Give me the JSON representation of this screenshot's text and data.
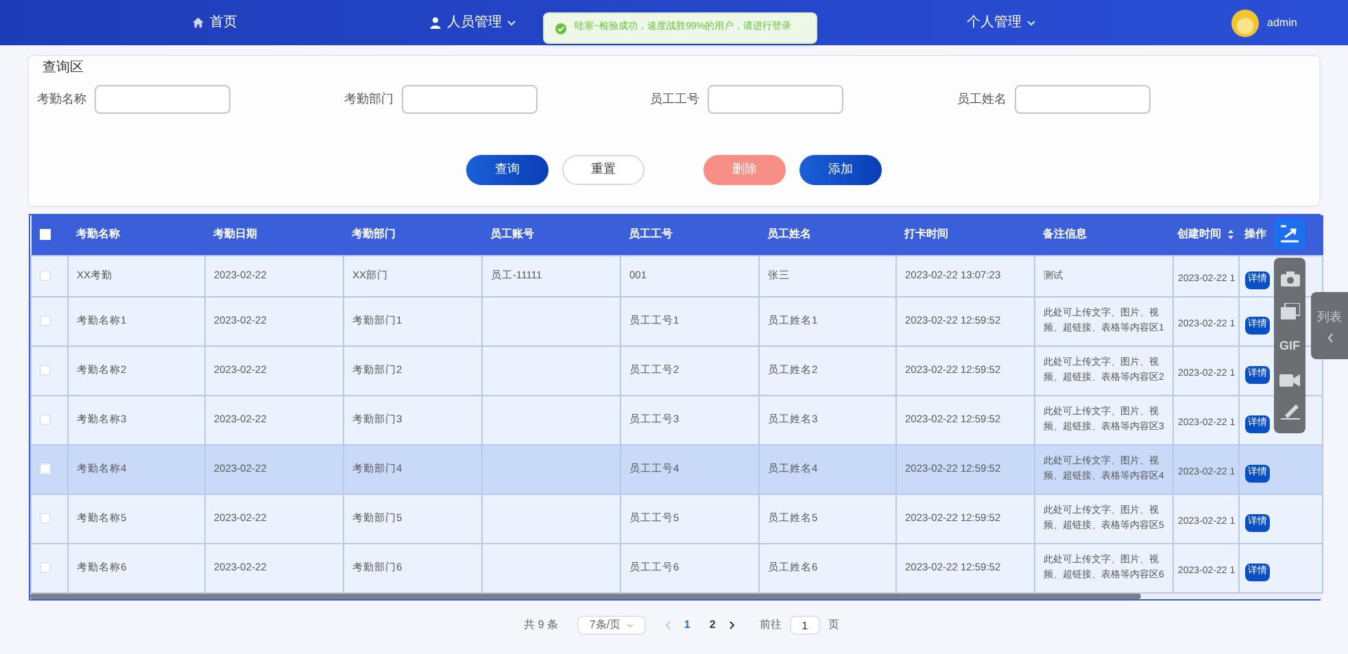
{
  "nav": {
    "items": [
      {
        "label": "首页",
        "kind": "home",
        "caret": false
      },
      {
        "label": "人员管理",
        "kind": "user",
        "caret": true
      },
      {
        "label": "个人管理",
        "kind": "plain",
        "caret": true
      }
    ],
    "user": "admin"
  },
  "toast": {
    "message": "哇塞~检验成功，速度战胜99%的用户，请进行登录"
  },
  "search": {
    "title": "查询区",
    "fields": [
      {
        "label": "考勤名称"
      },
      {
        "label": "考勤部门"
      },
      {
        "label": "员工工号"
      },
      {
        "label": "员工姓名"
      }
    ],
    "buttons": [
      {
        "label": "查询",
        "kind": "primary"
      },
      {
        "label": "重置",
        "kind": "plain"
      },
      {
        "label": "删除",
        "kind": "danger"
      },
      {
        "label": "添加",
        "kind": "primary"
      }
    ]
  },
  "table": {
    "all_checked": false,
    "columns": [
      {
        "label": "考勤名称",
        "sortable": false
      },
      {
        "label": "考勤日期",
        "sortable": false
      },
      {
        "label": "考勤部门",
        "sortable": false
      },
      {
        "label": "员工账号",
        "sortable": false
      },
      {
        "label": "员工工号",
        "sortable": false
      },
      {
        "label": "员工姓名",
        "sortable": false
      },
      {
        "label": "打卡时间",
        "sortable": false
      },
      {
        "label": "备注信息",
        "sortable": false
      },
      {
        "label": "创建时间",
        "sortable": true
      },
      {
        "label": "操作",
        "sortable": false
      }
    ],
    "rows": [
      {
        "checked": false,
        "hovered": false,
        "cells": [
          "XX考勤",
          "2023-02-22",
          "XX部门",
          "员工-11111",
          "001",
          "张三",
          "2023-02-22 13:07:23",
          "测试",
          "2023-02-22 1"
        ],
        "action": "详情"
      },
      {
        "checked": false,
        "hovered": false,
        "cells": [
          "考勤名称1",
          "2023-02-22",
          "考勤部门1",
          "",
          "员工工号1",
          "员工姓名1",
          "2023-02-22 12:59:52",
          "此处可上传文字、图片、视频、超链接、表格等内容区1",
          "2023-02-22 1"
        ],
        "action": "详情"
      },
      {
        "checked": false,
        "hovered": false,
        "cells": [
          "考勤名称2",
          "2023-02-22",
          "考勤部门2",
          "",
          "员工工号2",
          "员工姓名2",
          "2023-02-22 12:59:52",
          "此处可上传文字、图片、视频、超链接、表格等内容区2",
          "2023-02-22 1"
        ],
        "action": "详情"
      },
      {
        "checked": false,
        "hovered": false,
        "cells": [
          "考勤名称3",
          "2023-02-22",
          "考勤部门3",
          "",
          "员工工号3",
          "员工姓名3",
          "2023-02-22 12:59:52",
          "此处可上传文字、图片、视频、超链接、表格等内容区3",
          "2023-02-22 1"
        ],
        "action": "详情"
      },
      {
        "checked": false,
        "hovered": true,
        "cells": [
          "考勤名称4",
          "2023-02-22",
          "考勤部门4",
          "",
          "员工工号4",
          "员工姓名4",
          "2023-02-22 12:59:52",
          "此处可上传文字、图片、视频、超链接、表格等内容区4",
          "2023-02-22 1"
        ],
        "action": "详情"
      },
      {
        "checked": false,
        "hovered": false,
        "cells": [
          "考勤名称5",
          "2023-02-22",
          "考勤部门5",
          "",
          "员工工号5",
          "员工姓名5",
          "2023-02-22 12:59:52",
          "此处可上传文字、图片、视频、超链接、表格等内容区5",
          "2023-02-22 1"
        ],
        "action": "详情"
      },
      {
        "checked": false,
        "hovered": false,
        "cells": [
          "考勤名称6",
          "2023-02-22",
          "考勤部门6",
          "",
          "员工工号6",
          "员工姓名6",
          "2023-02-22 12:59:52",
          "此处可上传文字、图片、视频、超链接、表格等内容区6",
          "2023-02-22 1"
        ],
        "action": "详情"
      }
    ]
  },
  "pagination": {
    "total": "共 9 条",
    "page_size": "7条/页",
    "pages": [
      {
        "label": "1",
        "selected": true
      },
      {
        "label": "2",
        "selected": false
      }
    ],
    "goto_label": "前往",
    "goto_value": "1",
    "goto_suffix": "页"
  },
  "overlay_toolbar": {
    "gif_label": "GIF"
  },
  "side_tab": {
    "label": "列表"
  }
}
